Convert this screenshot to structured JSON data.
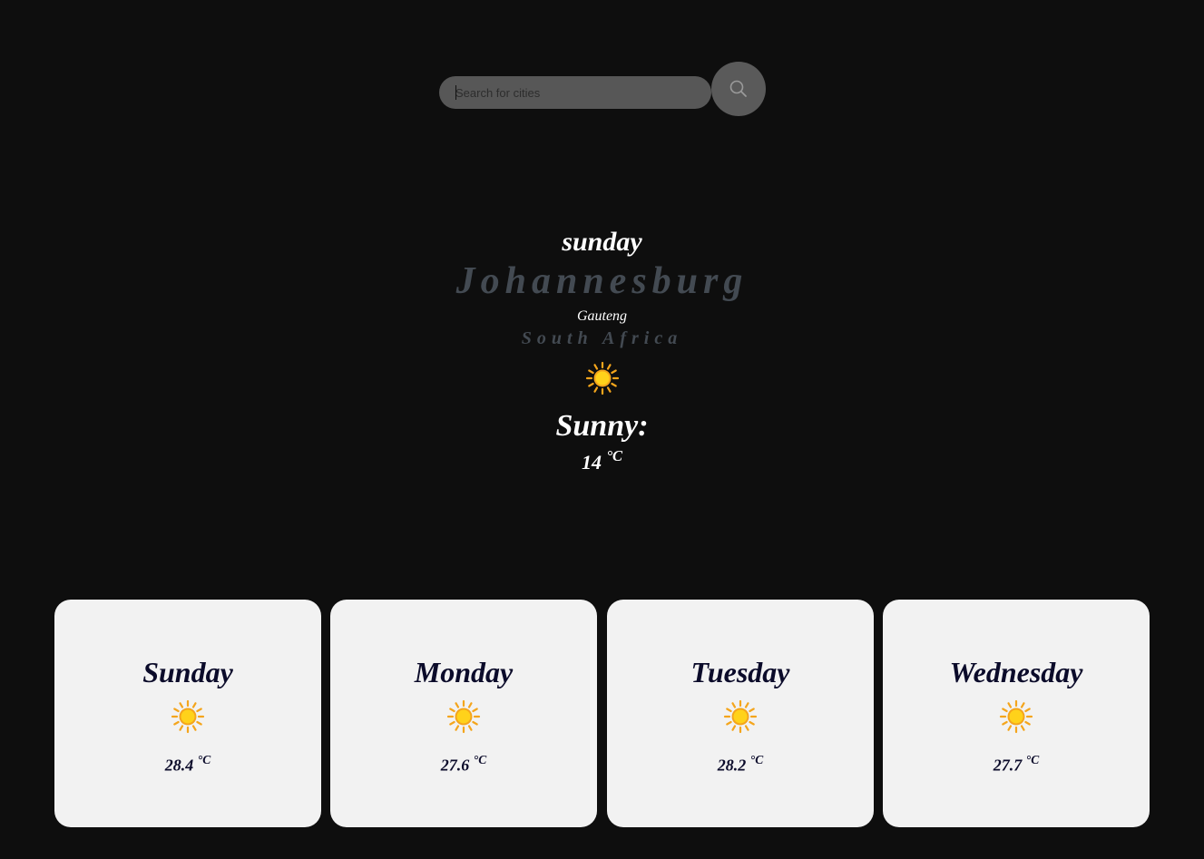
{
  "search": {
    "placeholder": "Search for cities",
    "button_icon": "search-icon"
  },
  "current": {
    "day": "sunday",
    "city": "Johannesburg",
    "region": "Gauteng",
    "country": "South Africa",
    "icon": "sun-icon",
    "condition": "Sunny:",
    "temp": "14",
    "unit": "°C"
  },
  "forecast": [
    {
      "day": "Sunday",
      "icon": "sun-icon",
      "temp": "28.4",
      "unit": "°C"
    },
    {
      "day": "Monday",
      "icon": "sun-icon",
      "temp": "27.6",
      "unit": "°C"
    },
    {
      "day": "Tuesday",
      "icon": "sun-icon",
      "temp": "28.2",
      "unit": "°C"
    },
    {
      "day": "Wednesday",
      "icon": "sun-icon",
      "temp": "27.7",
      "unit": "°C"
    }
  ],
  "colors": {
    "background": "#0e0e0e",
    "muted_text": "#434a52",
    "card": "#f2f2f2",
    "card_text": "#0b0b2a",
    "sun": "#ffd21a",
    "sun_rays": "#f4a51c"
  }
}
